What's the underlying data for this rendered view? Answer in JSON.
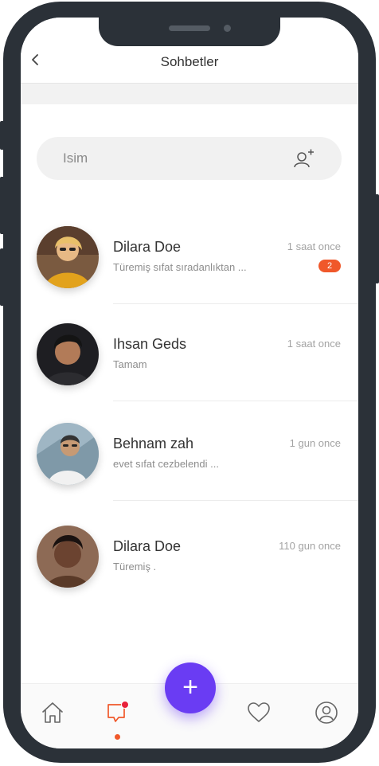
{
  "header": {
    "title": "Sohbetler"
  },
  "search": {
    "placeholder": "Isim"
  },
  "chats": [
    {
      "name": "Dilara Doe",
      "message": "Türemiş sıfat sıradanlıktan ...",
      "time": "1 saat once",
      "unread": "2"
    },
    {
      "name": "Ihsan Geds",
      "message": "Tamam",
      "time": "1 saat once"
    },
    {
      "name": "Behnam zah",
      "message": "evet sıfat cezbelendi ...",
      "time": "1 gun once"
    },
    {
      "name": "Dilara Doe",
      "message": "Türemiş .",
      "time": "110 gun once"
    }
  ],
  "fab": {
    "label": "+"
  },
  "tabs": [
    "home-icon",
    "chat-icon",
    "heart-icon",
    "profile-icon"
  ],
  "colors": {
    "accent": "#6a3cf3",
    "badge": "#f0582a",
    "frame": "#2b3138"
  }
}
